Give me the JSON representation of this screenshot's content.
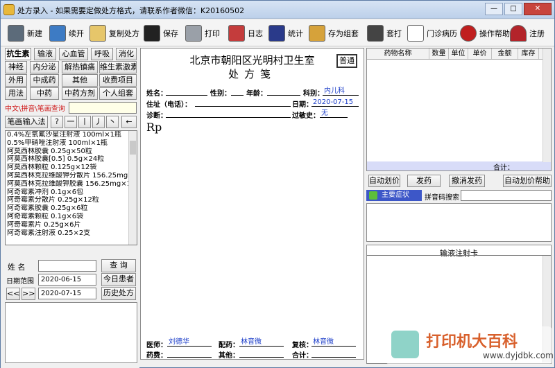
{
  "window": {
    "title": "处方录入 - 如果需要定做处方格式，请联系作者微信：K20160502",
    "min": "—",
    "max": "□",
    "close": "✕"
  },
  "toolbar": [
    "新建",
    "续开",
    "复制处方",
    "保存",
    "打印",
    "日志",
    "统计",
    "存为组套",
    "套打",
    "门诊病历",
    "操作帮助",
    "注册"
  ],
  "categories": [
    "抗生素",
    "输液",
    "心血管",
    "呼吸",
    "消化",
    "神经",
    "内分泌",
    "解热镇痛",
    "维生素激素",
    "外用",
    "中成药",
    "其他",
    "收费项目",
    "用法",
    "中药",
    "中药方剂",
    "个人组套"
  ],
  "search": {
    "label": "中文\\拼音\\笔画查询",
    "value": ""
  },
  "stroke": {
    "label": "笔画输入法",
    "keys": [
      "?",
      "一",
      "丨",
      "丿",
      "丶",
      "←"
    ]
  },
  "drugs": [
    "0.4%左氧氟沙星注射液 100ml×1瓶",
    "0.5%甲硝唑注射液 100ml×1瓶",
    "阿莫西林胶囊 0.25g×50粒",
    "阿莫西林胶囊[0.5] 0.5g×24粒",
    "阿莫西林颗粒 0.125g×12袋",
    "阿莫西林克拉维酸钾分散片 156.25mg×18片",
    "阿莫西林克拉维酸钾胶囊 156.25mg×18粒",
    "阿奇霉素冲剂 0.1g×6包",
    "阿奇霉素分散片 0.25g×12粒",
    "阿奇霉素胶囊 0.25g×6粒",
    "阿奇霉素颗粒 0.1g×6袋",
    "阿奇霉素片 0.25g×6片",
    "阿奇霉素注射液 0.25×2支"
  ],
  "patient": {
    "name_label": "姓  名",
    "name_value": "",
    "query_btn": "查 询",
    "date_label": "日期范围",
    "date_from": "2020-06-15",
    "date_to": "2020-07-15",
    "today_btn": "今日患者",
    "prev": "<<",
    "next": ">>",
    "history_btn": "历史处方"
  },
  "rx": {
    "hospital": "北京市朝阳区光明村卫生室",
    "title": "处方笺",
    "type": "普通",
    "name": "姓名：",
    "sex": "性别：",
    "age": "年龄：",
    "dept_label": "科别：",
    "dept": "内儿科",
    "addr": "住址（电话）：",
    "date_label": "日期：",
    "date": "2020-07-15",
    "diag": "诊断：",
    "allergy_label": "过敏史：",
    "allergy": "无",
    "rp": "Rp",
    "doctor_label": "医师：",
    "doctor": "刘德华",
    "dispense_label": "配药：",
    "dispense": "林音微",
    "check_label": "复核：",
    "check": "林音微",
    "drugfee_label": "药费：",
    "other_label": "其他：",
    "total_label": "合计："
  },
  "grid": {
    "cols": [
      "药物名称",
      "数量",
      "单位",
      "单价",
      "金额",
      "库存"
    ],
    "total": "合计："
  },
  "actions": [
    "自动划价",
    "发药",
    "撤消发药",
    "自动划价帮助"
  ],
  "symptom": {
    "tab": "主要症状",
    "pinyin": "拼音码搜索",
    "value": ""
  },
  "infusion": {
    "title": "输液注射卡"
  },
  "watermark": {
    "text": "打印机大百科",
    "url": "www.dyjdbk.com"
  }
}
